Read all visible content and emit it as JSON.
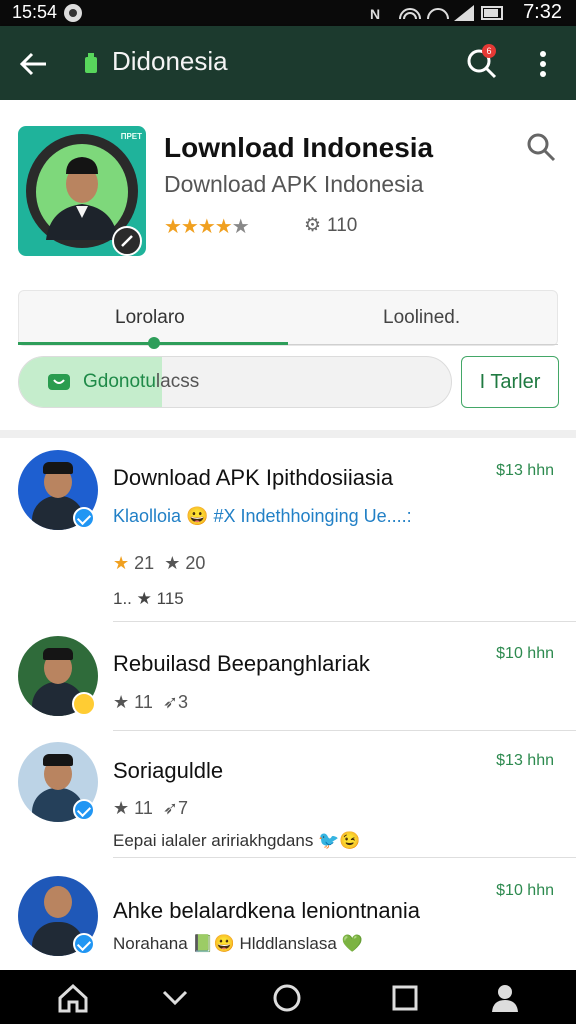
{
  "status_bar": {
    "time_left": "15:54",
    "icons": "NFC  WiFi  Signal  Battery",
    "time_right": "7:32"
  },
  "app_bar": {
    "title": "Didonesia",
    "notification_count": "6",
    "colors": {
      "background": "#1c3a2e",
      "accent": "#2e9e5a"
    }
  },
  "app_header": {
    "name": "Lownload Indonesia",
    "subtitle": "Download APK Indonesia",
    "rating": 4.5,
    "count": "110",
    "icon_tag": "ПРЕТ"
  },
  "tabs": [
    {
      "label": "Lorolaro"
    },
    {
      "label": "Loolined."
    }
  ],
  "progress": {
    "label_highlight": "Gdonotu",
    "label_rest": "lacss",
    "fraction": 0.33
  },
  "side_button": {
    "label": "I Tarler"
  },
  "items": [
    {
      "title": "Download APK Ipithdosiiasia",
      "price": "$13 hhn",
      "desc": "Klaolloia 😀 #X Indethhoinging Ue....:",
      "stars_line_1_gold": "21",
      "stars_line_1": "20",
      "stars_line_2_prefix": "1..",
      "stars_line_2": "115",
      "badge": "verified"
    },
    {
      "title": "Rebuilasd Beepanghlariak",
      "price": "$10 hhn",
      "stars_a": "11",
      "stars_b": "3",
      "badge": "emoji"
    },
    {
      "title": "Soriaguldle",
      "price": "$13 hhn",
      "stars_a": "11",
      "stars_b": "7",
      "desc": "Eepai ialaler aririakhgdans 🐦😉",
      "badge": "verified"
    },
    {
      "title": "Ahke belalardkena leniontnania",
      "price": "$10 hhn",
      "desc": "Norahana 📗😀 Hlddlanslasa 💚",
      "badge": "verified"
    }
  ],
  "nav_bar": {
    "buttons": [
      "home-icon",
      "chevron-down-icon",
      "circle-icon",
      "square-icon",
      "person-icon"
    ]
  }
}
